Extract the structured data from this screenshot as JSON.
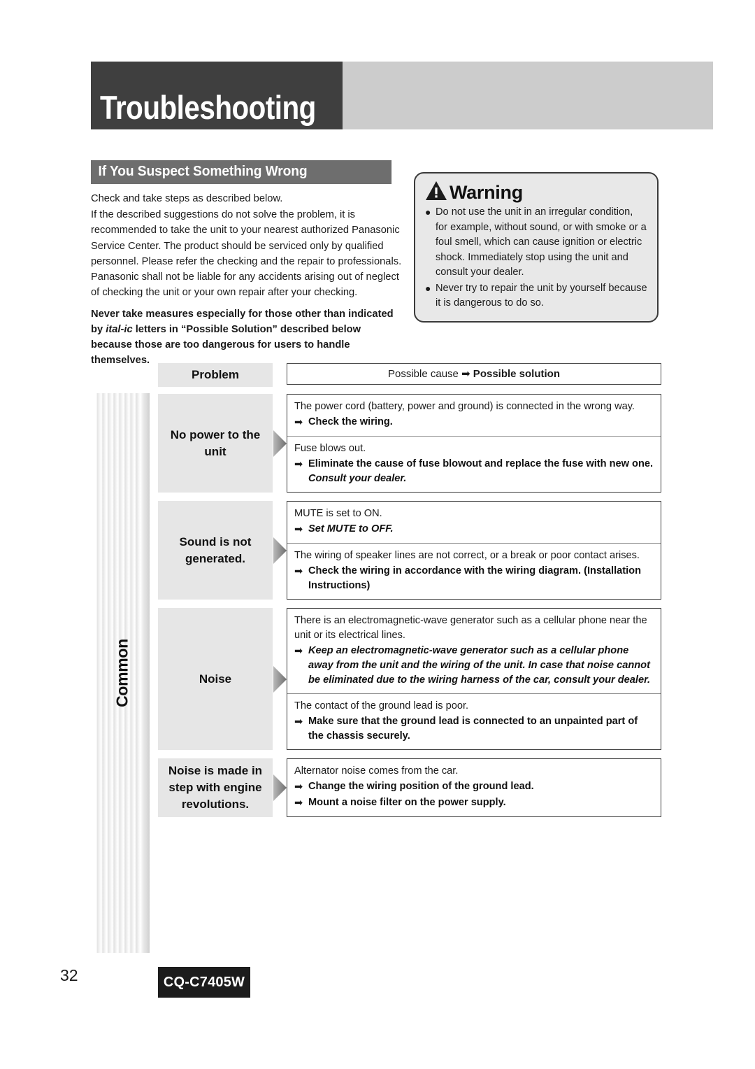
{
  "page": {
    "title": "Troubleshooting",
    "number": "32",
    "model": "CQ-C7405W",
    "side_tab_label": "Common"
  },
  "section": {
    "heading": "If You Suspect Something Wrong",
    "paragraph1": "Check and take steps as described below.",
    "paragraph2": "If the described suggestions do not solve the problem, it is recommended to take the unit to your nearest authorized Panasonic Service Center. The product should be serviced only by qualified personnel. Please refer the checking and the repair to professionals. Panasonic shall not be liable for any accidents arising out of neglect of checking the unit or your own repair after your checking.",
    "bold_notice_part1": "Never take measures especially for those other than indicated by ",
    "bold_notice_italic1": "ital-",
    "bold_notice_italic2": "ic",
    "bold_notice_part2": " letters in “Possible Solution” described below because those are too dangerous for users to handle themselves."
  },
  "warning": {
    "icon": "warning-triangle-icon",
    "title": "Warning",
    "items": [
      "Do not use the unit in an irregular condition, for example, without sound, or with smoke or a foul smell, which can cause ignition or electric shock. Immediately stop using the unit and consult your dealer.",
      "Never try to repair the unit by yourself because it is dangerous to do so."
    ],
    "bullet": "●"
  },
  "table": {
    "header": {
      "problem": "Problem",
      "cause_label": "Possible cause ",
      "arrow": "➡",
      "solution_label": " Possible solution"
    },
    "arrow_glyph": "➡",
    "rows": [
      {
        "problem": "No power to the unit",
        "cells": [
          {
            "cause": "The power cord (battery, power and ground) is connected in the wrong way.",
            "solution": "Check the wiring.",
            "solution_style": "bold",
            "solution_sub": ""
          },
          {
            "cause": "Fuse blows out.",
            "solution": "Eliminate the cause of fuse blowout and replace the fuse with new one.",
            "solution_style": "bold",
            "solution_sub": "Consult your dealer."
          }
        ]
      },
      {
        "problem": "Sound is not generated.",
        "cells": [
          {
            "cause": "MUTE is set to ON.",
            "solution": "Set MUTE to OFF.",
            "solution_style": "bold-italic",
            "solution_sub": ""
          },
          {
            "cause": "The wiring of speaker lines are not correct, or a break or poor contact arises.",
            "solution": "Check the wiring in accordance with the wiring diagram. (Installation Instructions)",
            "solution_style": "bold",
            "solution_sub": ""
          }
        ]
      },
      {
        "problem": "Noise",
        "cells": [
          {
            "cause": "There is an electromagnetic-wave generator such as a cellular phone near the unit or its electrical lines.",
            "solution": "Keep an electromagnetic-wave generator such as a cellular phone away from the unit and the wiring of the unit. In case that noise cannot be eliminated due to the wiring harness of the car, consult your dealer.",
            "solution_style": "bold-italic",
            "solution_sub": ""
          },
          {
            "cause": "The contact of the ground lead is poor.",
            "solution": "Make sure that the ground lead is connected to an unpainted part of the chassis securely.",
            "solution_style": "bold",
            "solution_sub": ""
          }
        ]
      },
      {
        "problem": "Noise is made in step with engine revolutions.",
        "cells": [
          {
            "cause": "Alternator noise comes from the car.",
            "solution": "Change the wiring position of the ground lead.",
            "solution_style": "bold",
            "solution2": "Mount a noise filter on the power supply.",
            "solution_sub": ""
          }
        ]
      }
    ]
  },
  "colors": {
    "header_dark": "#3f3f3f",
    "header_light": "#cccccc",
    "section_bar": "#6e6e6e",
    "cell_gray": "#e6e6e6",
    "warning_bg": "#e8e8e8",
    "badge_bg": "#1c1c1c"
  }
}
